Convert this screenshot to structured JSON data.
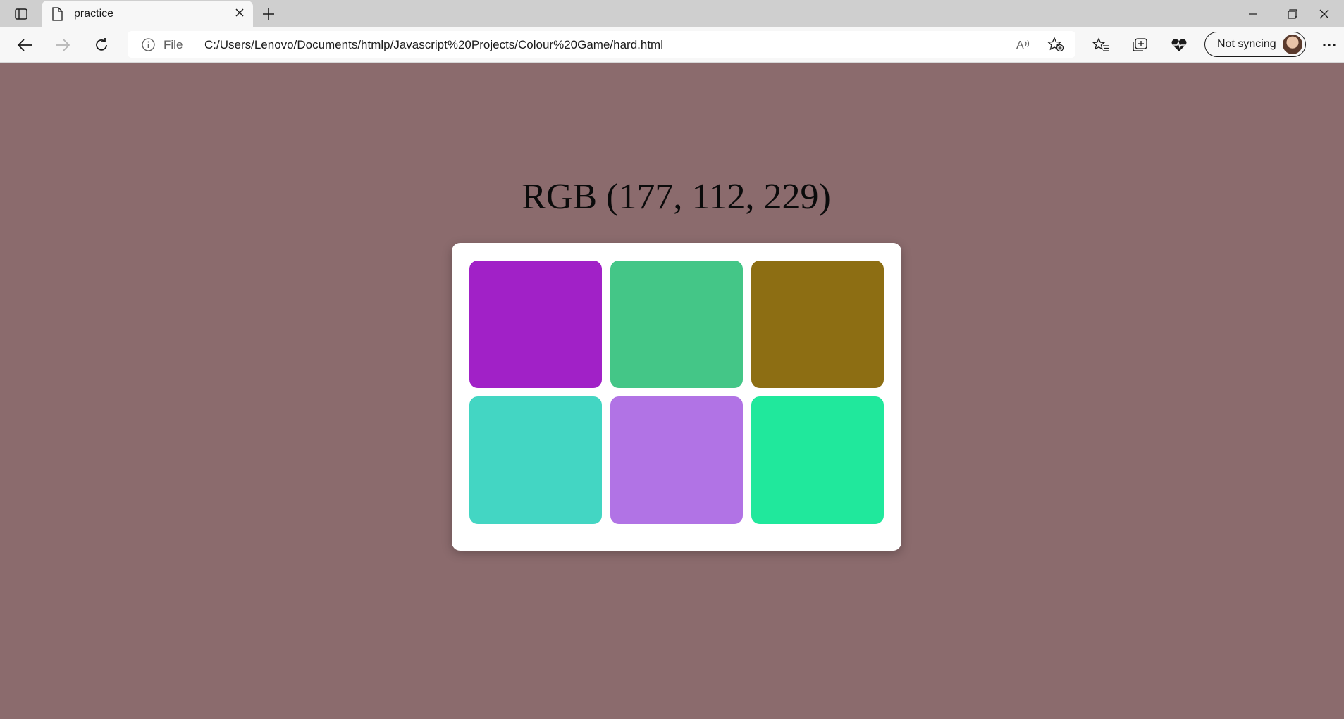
{
  "browser": {
    "tab": {
      "title": "practice"
    },
    "address": {
      "prefix": "File",
      "url": "C:/Users/Lenovo/Documents/htmlp/Javascript%20Projects/Colour%20Game/hard.html"
    },
    "profile": {
      "label": "Not syncing"
    },
    "icons": [
      "tab-actions-icon",
      "page-icon",
      "close-icon",
      "plus-icon",
      "minimize-icon",
      "restore-icon",
      "close-window-icon",
      "back-icon",
      "forward-icon",
      "refresh-icon",
      "info-icon",
      "read-aloud-icon",
      "add-favorite-icon",
      "favorites-icon",
      "collections-icon",
      "browser-essentials-icon",
      "more-icon"
    ]
  },
  "game": {
    "target": "RGB (177, 112, 229)",
    "background_color": "#8b6b6d",
    "tiles": [
      {
        "color": "#a121c7"
      },
      {
        "color": "#44c687"
      },
      {
        "color": "#8d6e13"
      },
      {
        "color": "#43d6c3"
      },
      {
        "color": "#b173e5"
      },
      {
        "color": "#20e89c"
      }
    ]
  }
}
